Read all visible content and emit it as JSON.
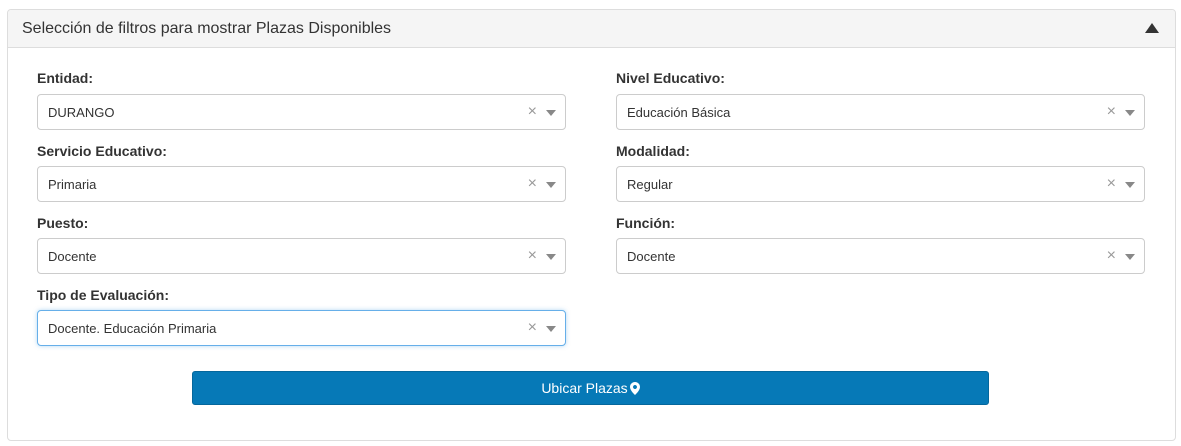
{
  "panel": {
    "title": "Selección de filtros para mostrar Plazas Disponibles"
  },
  "fields": {
    "entidad": {
      "label": "Entidad:",
      "value": "DURANGO"
    },
    "nivel_educativo": {
      "label": "Nivel Educativo:",
      "value": "Educación Básica"
    },
    "servicio_educativo": {
      "label": "Servicio Educativo:",
      "value": "Primaria"
    },
    "modalidad": {
      "label": "Modalidad:",
      "value": "Regular"
    },
    "puesto": {
      "label": "Puesto:",
      "value": "Docente"
    },
    "funcion": {
      "label": "Función:",
      "value": "Docente"
    },
    "tipo_evaluacion": {
      "label": "Tipo de Evaluación:",
      "value": "Docente. Educación Primaria"
    }
  },
  "clear_glyph": "×",
  "button": {
    "label": "Ubicar Plazas",
    "icon": "map-marker-icon",
    "color": "#0679b7"
  },
  "icons": {
    "collapse": "triangle-up-icon",
    "dropdown": "caret-down-icon",
    "clear": "clear-icon"
  }
}
